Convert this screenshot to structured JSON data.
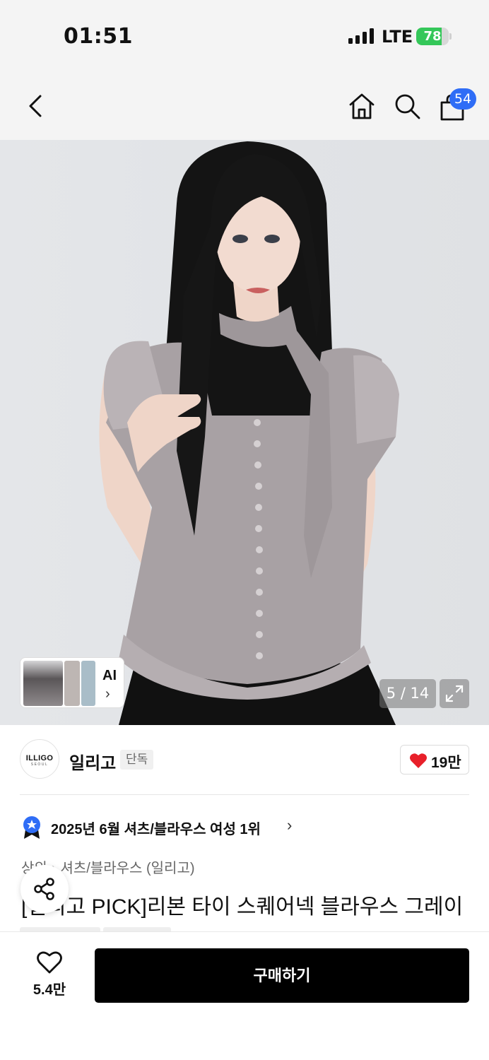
{
  "status_bar": {
    "time": "01:51",
    "network": "LTE",
    "battery": "78",
    "battery_level": 0.78,
    "battery_color": "#34c759"
  },
  "nav": {
    "back_icon": "chevron-left-icon",
    "home_icon": "home-icon",
    "search_icon": "search-icon",
    "cart_icon": "shopping-bag-icon",
    "cart_count": "54",
    "badge_color": "#2f6df6"
  },
  "gallery": {
    "ai_label": "AI",
    "ai_chevron": "›",
    "page_counter": "5 / 14",
    "expand_icon": "expand-icon"
  },
  "brand": {
    "logo_text": "ILLIGO",
    "logo_sub": "SEOUL",
    "name": "일리고",
    "badge": "단독",
    "like_count": "19만",
    "heart_color": "#e8202a"
  },
  "ranking": {
    "text": "2025년 6월 셔츠/블라우스 여성 1위",
    "chevron": "›",
    "icon": "ranking-medal-icon"
  },
  "breadcrumb": {
    "items": [
      "상의",
      "셔츠/블라우스 (일리고)"
    ],
    "separator": "›"
  },
  "product": {
    "title": "[일리고 PICK]리본 타이 스퀘어넥 블라우스 그레이"
  },
  "share": {
    "icon": "share-icon"
  },
  "bottom_bar": {
    "wish_count": "5.4만",
    "wish_icon": "heart-outline-icon",
    "buy_label": "구매하기"
  }
}
